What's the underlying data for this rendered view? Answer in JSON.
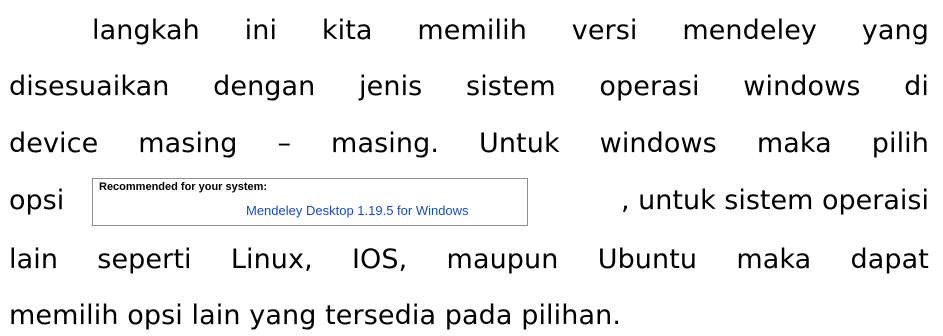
{
  "paragraph": {
    "line1": "langkah ini kita memilih versi mendeley yang",
    "line2": "disesuaikan dengan jenis sistem operasi windows di",
    "line3": "device masing – masing. Untuk windows maka pilih",
    "line4_before": "opsi",
    "line4_after": ", untuk sistem operaisi",
    "line5": "lain seperti Linux, IOS, maupun Ubuntu maka dapat",
    "line6": "memilih opsi lain yang tersedia pada pilihan."
  },
  "embedded_screenshot": {
    "title": "Recommended for your system:",
    "link": "Mendeley Desktop 1.19.5 for Windows"
  }
}
